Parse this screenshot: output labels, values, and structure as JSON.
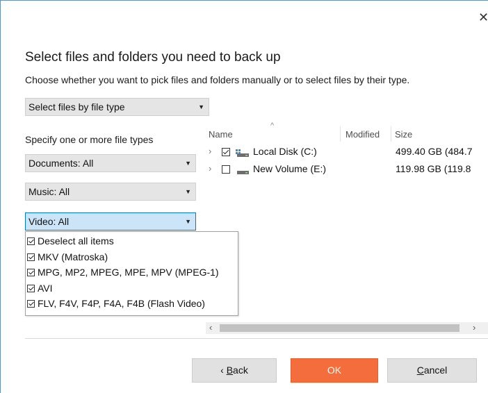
{
  "window": {
    "close_glyph": "✕"
  },
  "header": {
    "title": "Select files and folders you need to back up",
    "subtitle": "Choose whether you want to pick files and folders manually or to select files by their type."
  },
  "mode_select": {
    "value": "Select files by file type"
  },
  "file_types": {
    "label": "Specify one or more file types",
    "documents": "Documents: All",
    "music": "Music: All",
    "video": "Video: All"
  },
  "video_dropdown": {
    "items": [
      {
        "label": "Deselect all items",
        "checked": true
      },
      {
        "label": "MKV (Matroska)",
        "checked": true
      },
      {
        "label": "MPG, MP2, MPEG, MPE, MPV (MPEG-1)",
        "checked": true
      },
      {
        "label": "AVI",
        "checked": true
      },
      {
        "label": "FLV, F4V, F4P, F4A, F4B (Flash Video)",
        "checked": true
      }
    ]
  },
  "tree": {
    "columns": {
      "name": "Name",
      "modified": "Modified",
      "size": "Size"
    },
    "rows": [
      {
        "name": "Local Disk (C:)",
        "size": "499.40 GB (484.7",
        "checked": true,
        "icon": "windows-drive-icon"
      },
      {
        "name": "New Volume (E:)",
        "size": "119.98 GB (119.8",
        "checked": false,
        "icon": "drive-icon"
      }
    ]
  },
  "buttons": {
    "back_prefix": "‹ ",
    "back_key": "B",
    "back_rest": "ack",
    "ok": "OK",
    "cancel_key": "C",
    "cancel_rest": "ancel"
  },
  "colors": {
    "accent": "#f36e3c",
    "selection": "#cce4f7",
    "focus": "#0078d7"
  }
}
